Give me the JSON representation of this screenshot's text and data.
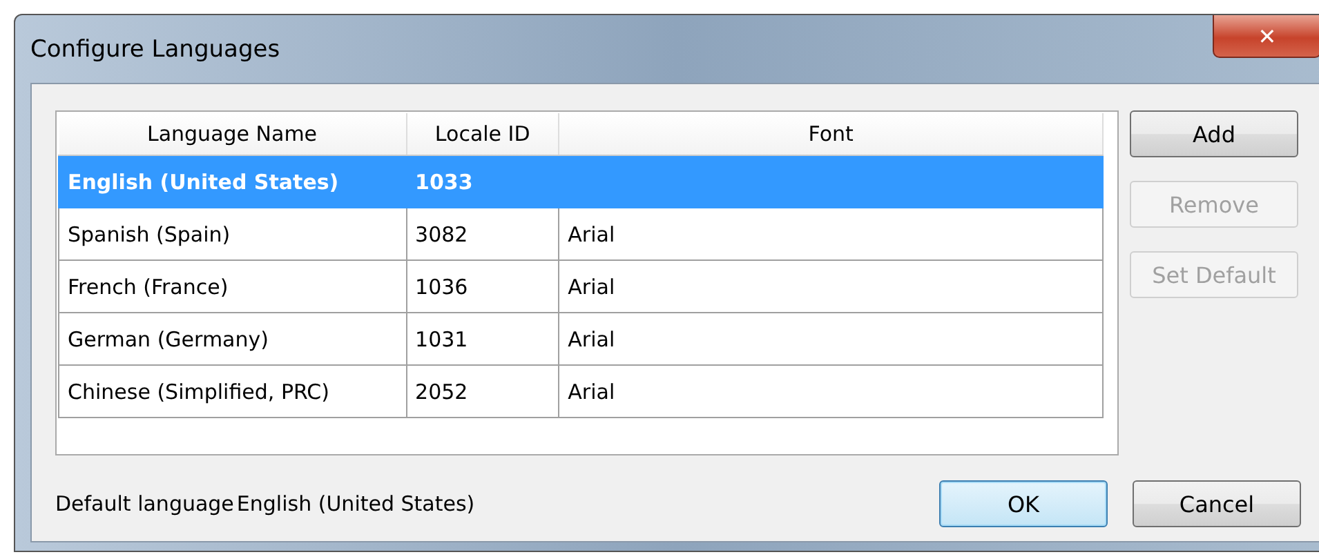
{
  "window": {
    "title": "Configure Languages",
    "close": "✕"
  },
  "table": {
    "columns": [
      "Language Name",
      "Locale ID",
      "Font"
    ],
    "rows": [
      {
        "cells": [
          "English (United States)",
          "1033",
          ""
        ],
        "selected": true
      },
      {
        "cells": [
          "Spanish (Spain)",
          "3082",
          "Arial"
        ],
        "selected": false
      },
      {
        "cells": [
          "French (France)",
          "1036",
          "Arial"
        ],
        "selected": false
      },
      {
        "cells": [
          "German (Germany)",
          "1031",
          "Arial"
        ],
        "selected": false
      },
      {
        "cells": [
          "Chinese (Simplified, PRC)",
          "2052",
          "Arial"
        ],
        "selected": false
      }
    ]
  },
  "side_buttons": [
    {
      "label": "Add",
      "disabled": false
    },
    {
      "label": "Remove",
      "disabled": true
    },
    {
      "label": "Set Default",
      "disabled": true
    }
  ],
  "default_language": {
    "label": "Default language",
    "value": "English (United States)"
  },
  "buttons": [
    {
      "label": "OK",
      "focused": true
    },
    {
      "label": "Cancel",
      "focused": false
    }
  ]
}
